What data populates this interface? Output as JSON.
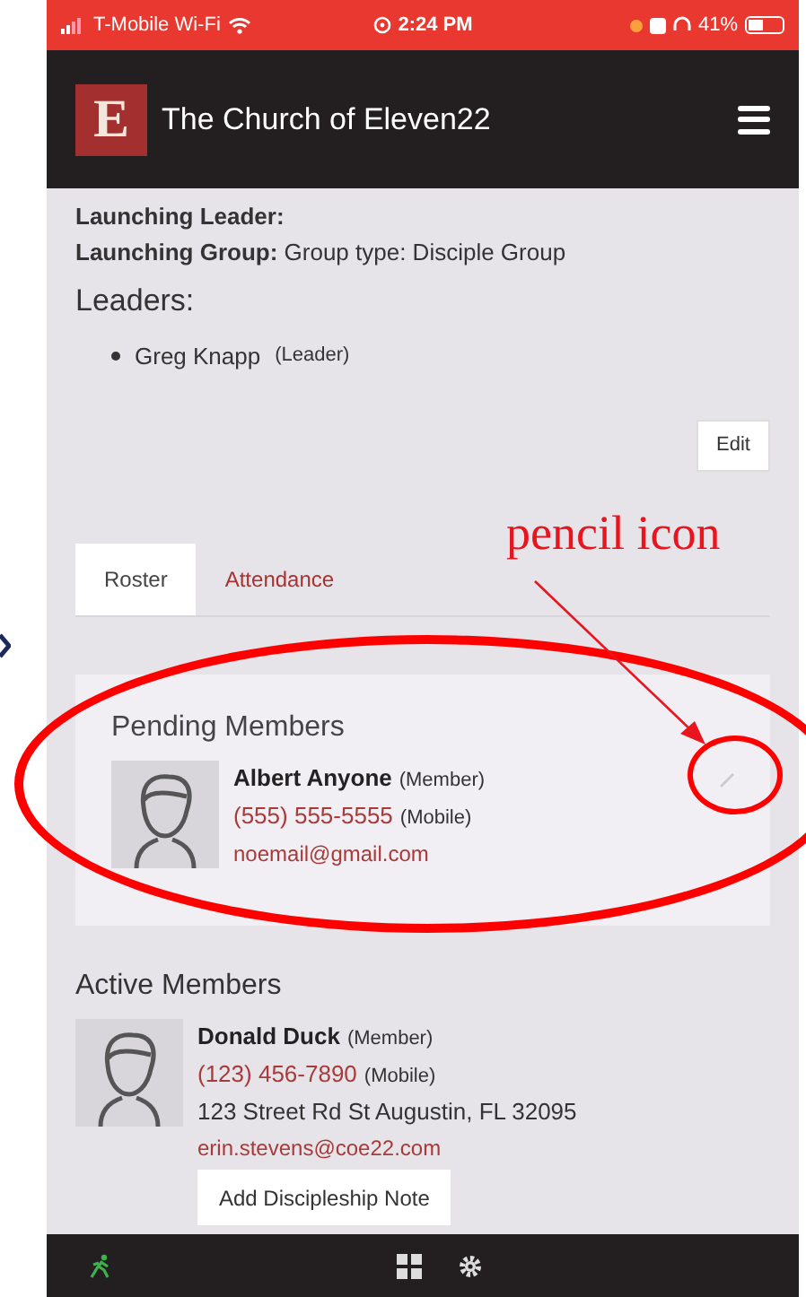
{
  "status_bar": {
    "carrier": "T-Mobile Wi-Fi",
    "time": "2:24 PM",
    "battery": "41%"
  },
  "header": {
    "logo": "E",
    "title": "The Church of Eleven22"
  },
  "info": [
    "**Launching Leader:**",
    "**Launching Group:** Group type: Disciple Group"
  ],
  "leaders": {
    "heading": "Leaders:",
    "items": [
      {
        "name": "Greg Knapp",
        "role": "(Leader)"
      }
    ]
  },
  "edit_button": "Edit",
  "tabs": [
    {
      "label": "Roster",
      "selected": true
    },
    {
      "label": "Attendance",
      "selected": false
    }
  ],
  "pending": {
    "heading": "Pending Members",
    "members": [
      {
        "name": "Albert Anyone",
        "role": "(Member)",
        "phone": "(555) 555-5555",
        "phone_type": "(Mobile)",
        "email": "noemail@gmail.com"
      }
    ]
  },
  "active": {
    "heading": "Active Members",
    "members": [
      {
        "name": "Donald Duck",
        "role": "(Member)",
        "phone": "(123) 456-7890",
        "phone_type": "(Mobile)",
        "address": "123 Street Rd St Augustin, FL 32095",
        "email": "erin.stevens@coe22.com",
        "note_button": "Add Discipleship Note"
      }
    ]
  },
  "annotation": {
    "label": "pencil icon"
  }
}
